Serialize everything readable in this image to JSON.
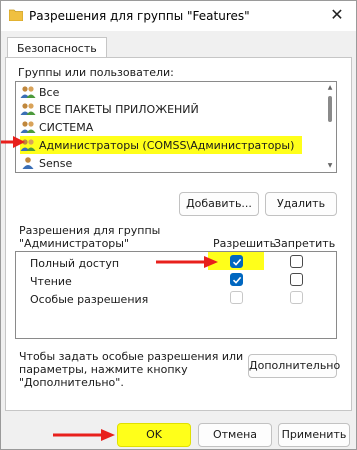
{
  "window": {
    "title": "Разрешения для группы \"Features\"",
    "close_glyph": "✕"
  },
  "tabs": [
    {
      "label": "Безопасность"
    }
  ],
  "groups": {
    "label": "Группы или пользователи:",
    "items": [
      {
        "label": "Все",
        "selected": false
      },
      {
        "label": "ВСЕ ПАКЕТЫ ПРИЛОЖЕНИЙ",
        "selected": false
      },
      {
        "label": "СИСТЕМА",
        "selected": false
      },
      {
        "label": "Администраторы (COMSS\\Администраторы)",
        "selected": true
      },
      {
        "label": "Sense",
        "selected": false
      }
    ],
    "add_label": "Добавить...",
    "remove_label": "Удалить"
  },
  "permissions": {
    "label_line1": "Разрешения для группы",
    "label_line2": "\"Администраторы\"",
    "allow_header": "Разрешить",
    "deny_header": "Запретить",
    "rows": [
      {
        "label": "Полный доступ",
        "allow": true,
        "allow_enabled": true,
        "deny": false,
        "deny_enabled": true
      },
      {
        "label": "Чтение",
        "allow": true,
        "allow_enabled": true,
        "deny": false,
        "deny_enabled": true
      },
      {
        "label": "Особые разрешения",
        "allow": false,
        "allow_enabled": false,
        "deny": false,
        "deny_enabled": false
      }
    ]
  },
  "advanced": {
    "hint_line1": "Чтобы задать особые разрешения или",
    "hint_line2": "параметры, нажмите кнопку",
    "hint_line3": "\"Дополнительно\".",
    "button_label": "Дополнительно"
  },
  "footer": {
    "ok_label": "OK",
    "cancel_label": "Отмена",
    "apply_label": "Применить"
  },
  "colors": {
    "highlight": "#ffff1a",
    "arrow": "#e8201c",
    "checkbox_checked": "#0067c0"
  }
}
